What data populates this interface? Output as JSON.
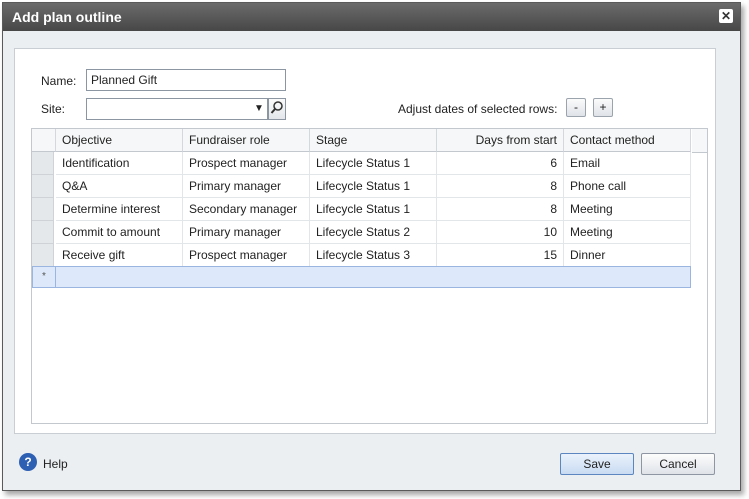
{
  "dialog": {
    "title": "Add plan outline"
  },
  "form": {
    "name_label": "Name:",
    "name_value": "Planned Gift",
    "site_label": "Site:",
    "site_value": "",
    "adjust_label": "Adjust dates of selected rows:",
    "decrease_label": "-",
    "increase_label": "+"
  },
  "grid": {
    "columns": [
      "Objective",
      "Fundraiser role",
      "Stage",
      "Days from start",
      "Contact method"
    ],
    "rows": [
      [
        "Identification",
        "Prospect manager",
        "Lifecycle Status 1",
        "6",
        "Email"
      ],
      [
        "Q&A",
        "Primary manager",
        "Lifecycle Status 1",
        "8",
        "Phone call"
      ],
      [
        "Determine interest",
        "Secondary manager",
        "Lifecycle Status 1",
        "8",
        "Meeting"
      ],
      [
        "Commit to amount",
        "Primary manager",
        "Lifecycle Status 2",
        "10",
        "Meeting"
      ],
      [
        "Receive gift",
        "Prospect manager",
        "Lifecycle Status 3",
        "15",
        "Dinner"
      ]
    ],
    "new_row_marker": "*"
  },
  "footer": {
    "help_label": "Help",
    "save_label": "Save",
    "cancel_label": "Cancel"
  }
}
